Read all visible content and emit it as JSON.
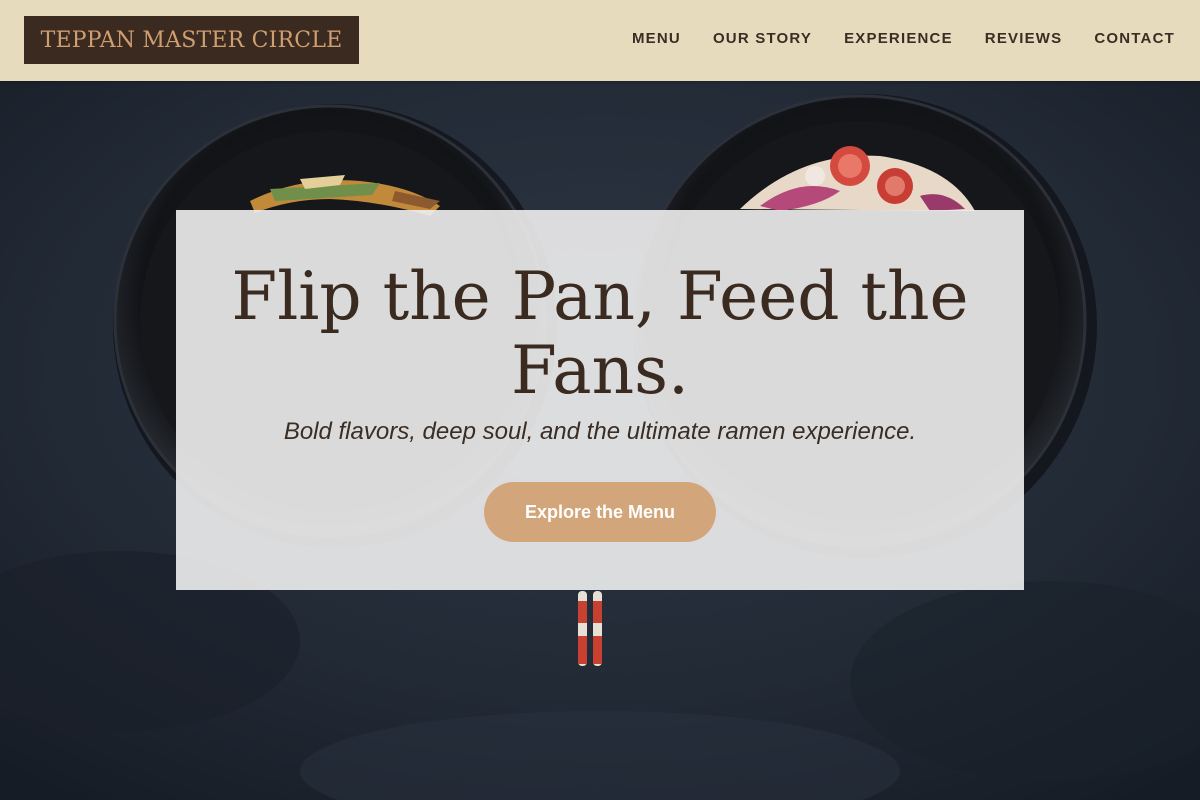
{
  "header": {
    "logo_text": "TEPPAN MASTER CIRCLE",
    "nav": [
      {
        "label": "MENU"
      },
      {
        "label": "OUR STORY"
      },
      {
        "label": "EXPERIENCE"
      },
      {
        "label": "REVIEWS"
      },
      {
        "label": "CONTACT"
      }
    ]
  },
  "hero": {
    "background_image": "two-ramen-bowls-with-chopsticks",
    "title": "Flip the Pan, Feed the Fans.",
    "subtitle": "Bold flavors, deep soul, and the ultimate ramen experience.",
    "cta_label": "Explore the Menu"
  },
  "colors": {
    "header_bg": "#e6dcbd",
    "logo_bg": "#3b2a1f",
    "logo_text": "#cf9f72",
    "title_text": "#3b2a1f",
    "cta_bg": "#d3a57a",
    "cta_text": "#ffffff",
    "hero_bg": "#1b222d"
  }
}
